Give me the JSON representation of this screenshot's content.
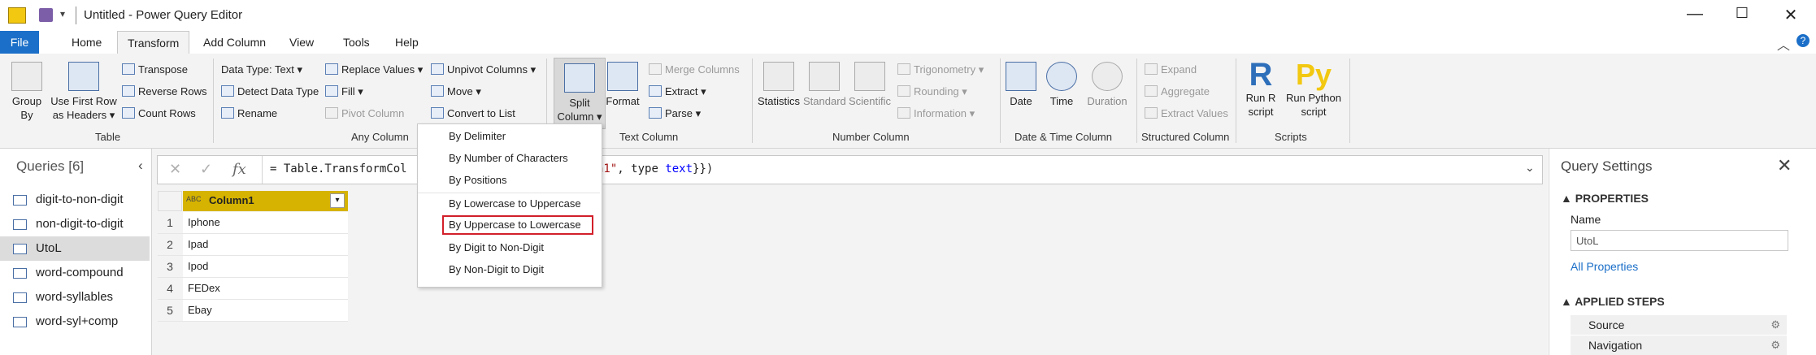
{
  "window": {
    "title": "Untitled - Power Query Editor",
    "minimize": "—",
    "maximize": "☐",
    "close": "✕"
  },
  "tabs": [
    "File",
    "Home",
    "Transform",
    "Add Column",
    "View",
    "Tools",
    "Help"
  ],
  "active_tab": "Transform",
  "ribbon": {
    "group_by": "Group\nBy",
    "group_by_l1": "Group",
    "group_by_l2": "By",
    "first_row_l1": "Use First Row",
    "first_row_l2": "as Headers ▾",
    "transpose": "Transpose",
    "reverse_rows": "Reverse Rows",
    "count_rows": "Count Rows",
    "table_group": "Table",
    "data_type": "Data Type: Text ▾",
    "detect_data_type": "Detect Data Type",
    "rename": "Rename",
    "replace_values": "Replace Values ▾",
    "fill": "Fill ▾",
    "pivot_column": "Pivot Column",
    "unpivot_columns": "Unpivot Columns ▾",
    "move": "Move ▾",
    "convert_to_list": "Convert to List",
    "any_column_group": "Any Column",
    "split_l1": "Split",
    "split_l2": "Column ▾",
    "format": "Format",
    "merge_columns": "Merge Columns",
    "extract": "Extract ▾",
    "parse": "Parse ▾",
    "text_column_group": "Text Column",
    "statistics": "Statistics",
    "standard": "Standard",
    "scientific": "Scientific",
    "trigonometry": "Trigonometry ▾",
    "rounding": "Rounding ▾",
    "information": "Information ▾",
    "number_column_group": "Number Column",
    "date": "Date",
    "time": "Time",
    "duration": "Duration",
    "datetime_group": "Date & Time Column",
    "expand": "Expand",
    "aggregate": "Aggregate",
    "extract_values": "Extract Values",
    "structured_group": "Structured Column",
    "run_r_l1": "Run R",
    "run_r_l2": "script",
    "run_py_l1": "Run Python",
    "run_py_l2": "script",
    "scripts_group": "Scripts"
  },
  "split_menu": {
    "items": [
      "By Delimiter",
      "By Number of Characters",
      "By Positions",
      "By Lowercase to Uppercase",
      "By Uppercase to Lowercase",
      "By Digit to Non-Digit",
      "By Non-Digit to Digit"
    ],
    "highlighted": "By Uppercase to Lowercase"
  },
  "queries": {
    "header": "Queries [6]",
    "items": [
      "digit-to-non-digit",
      "non-digit-to-digit",
      "UtoL",
      "word-compound",
      "word-syllables",
      "word-syl+comp"
    ],
    "selected": "UtoL"
  },
  "formula_bar": {
    "left": "= Table.TransformCol",
    "right_str": "n1\"",
    "right_rest": ", type ",
    "right_kw": "text",
    "right_end": "}})"
  },
  "grid": {
    "column_header": "Column1",
    "type_badge": "ABC",
    "rows": [
      {
        "n": "1",
        "v": "Iphone"
      },
      {
        "n": "2",
        "v": "Ipad"
      },
      {
        "n": "3",
        "v": "Ipod"
      },
      {
        "n": "4",
        "v": "FEDex"
      },
      {
        "n": "5",
        "v": "Ebay"
      }
    ]
  },
  "query_settings": {
    "title": "Query Settings",
    "properties": "PROPERTIES",
    "name_label": "Name",
    "name_value": "UtoL",
    "all_properties": "All Properties",
    "applied_steps": "APPLIED STEPS",
    "steps": [
      "Source",
      "Navigation"
    ]
  },
  "colors": {
    "file_tab": "#1b6fc8",
    "header_gold": "#d6b300",
    "highlight_red": "#d21f2a",
    "python_yellow": "#f2c811",
    "r_blue": "#2e6fba"
  }
}
